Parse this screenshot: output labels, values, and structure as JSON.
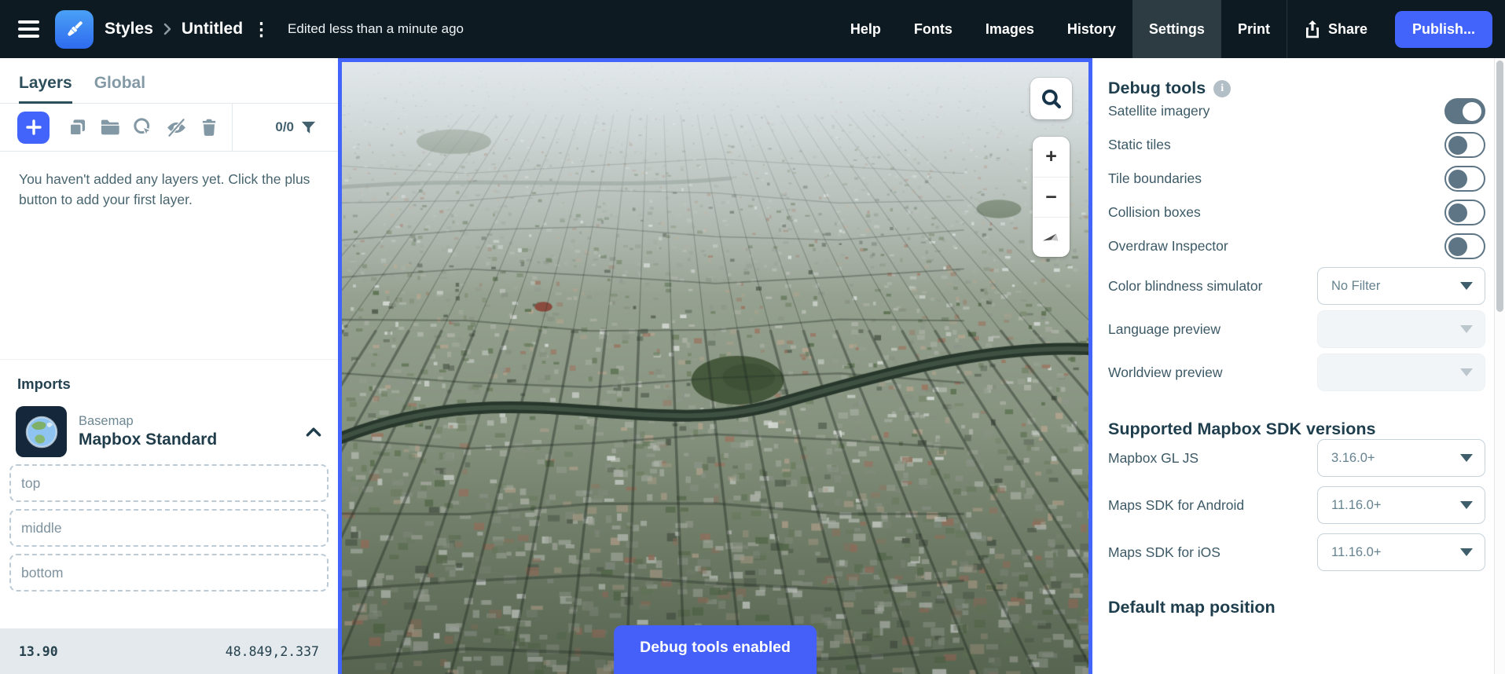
{
  "topbar": {
    "breadcrumb": {
      "root": "Styles",
      "current": "Untitled"
    },
    "edited_status": "Edited less than a minute ago",
    "nav_items": [
      {
        "label": "Help",
        "active": false
      },
      {
        "label": "Fonts",
        "active": false
      },
      {
        "label": "Images",
        "active": false
      },
      {
        "label": "History",
        "active": false
      },
      {
        "label": "Settings",
        "active": true
      },
      {
        "label": "Print",
        "active": false
      }
    ],
    "share_label": "Share",
    "publish_label": "Publish...",
    "colors": {
      "bar_bg": "#0d1a21",
      "active_tab_bg": "#2d3c43",
      "accent_blue": "#4264fb"
    }
  },
  "sidebar": {
    "tabs": [
      {
        "label": "Layers",
        "active": true
      },
      {
        "label": "Global",
        "active": false
      }
    ],
    "layer_counter": "0/0",
    "empty_state": "You haven't added any layers yet. Click the plus button to add your first layer.",
    "imports": {
      "heading": "Imports",
      "item": {
        "kind": "Basemap",
        "name": "Mapbox Standard",
        "expanded": true
      },
      "slots": [
        "top",
        "middle",
        "bottom"
      ]
    },
    "statusbar": {
      "zoom": "13.90",
      "coords": "48.849,2.337"
    }
  },
  "map": {
    "location": "satellite view of Paris",
    "toast": "Debug tools enabled",
    "controls": {
      "zoom_in": "+",
      "zoom_out": "−"
    },
    "border_color": "#4264fb"
  },
  "panel": {
    "debug": {
      "heading": "Debug tools",
      "toggles": [
        {
          "label": "Satellite imagery",
          "on": true
        },
        {
          "label": "Static tiles",
          "on": false
        },
        {
          "label": "Tile boundaries",
          "on": false
        },
        {
          "label": "Collision boxes",
          "on": false
        },
        {
          "label": "Overdraw Inspector",
          "on": false
        }
      ],
      "selects": [
        {
          "label": "Color blindness simulator",
          "value": "No Filter",
          "disabled": false
        },
        {
          "label": "Language preview",
          "value": "",
          "disabled": true
        },
        {
          "label": "Worldview preview",
          "value": "",
          "disabled": true
        }
      ],
      "toggle_on_color": "#5d7585"
    },
    "sdk": {
      "heading": "Supported Mapbox SDK versions",
      "rows": [
        {
          "label": "Mapbox GL JS",
          "value": "3.16.0+"
        },
        {
          "label": "Maps SDK for Android",
          "value": "11.16.0+"
        },
        {
          "label": "Maps SDK for iOS",
          "value": "11.16.0+"
        }
      ]
    },
    "map_position": {
      "heading": "Default map position"
    }
  }
}
